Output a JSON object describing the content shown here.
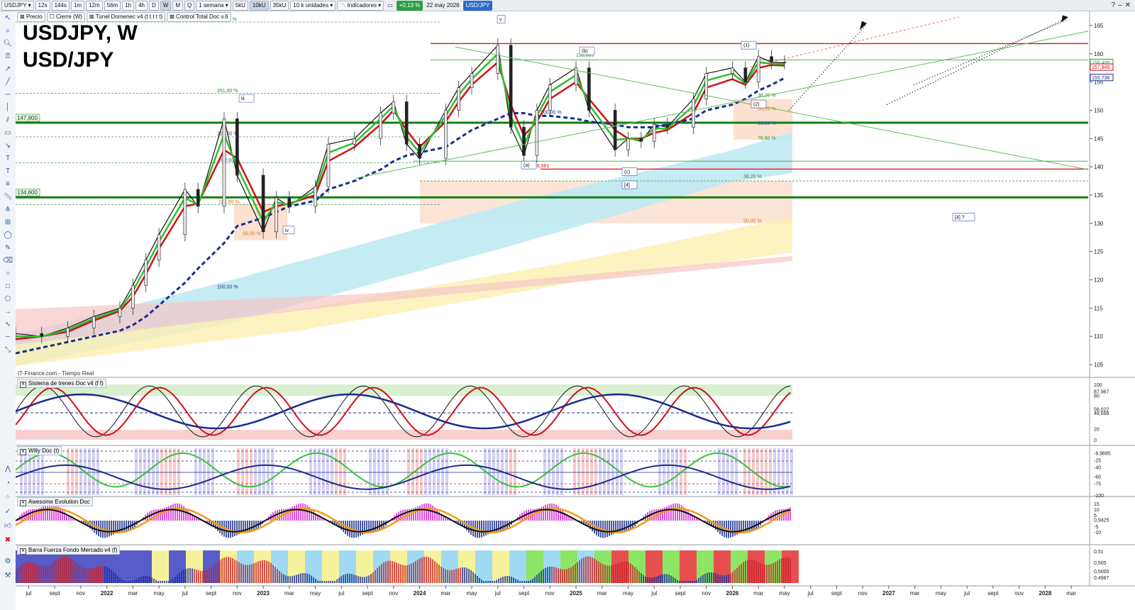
{
  "toolbar": {
    "symbol": "USDJPY",
    "intervals": [
      "12s",
      "144s",
      "1m",
      "12m",
      "56m",
      "1h",
      "4h",
      "D",
      "W",
      "M",
      "Q"
    ],
    "active_interval": "W",
    "period": "1 semana",
    "units": [
      "5kU",
      "10kU",
      "35kU"
    ],
    "active_unit": "10kU",
    "quantity": "10 k unidades",
    "indicators_label": "Indicadores",
    "change": "+0,13 %",
    "date": "22 may 2026",
    "pair_badge": "USD/JPY",
    "window_icons": [
      "help-icon",
      "minimize-icon",
      "close-icon"
    ]
  },
  "legend_bar": {
    "items": [
      "Precio",
      "Cierre (W)",
      "Tunel Domenec v4 (t t t t t)",
      "Control Total Doc v.6"
    ]
  },
  "main_title": {
    "line1": "USDJPY, W",
    "line2": "USD/JPY"
  },
  "watermark": "IT-Finance.com - Tiempo Real",
  "price_axis": {
    "ticks": [
      "165",
      "160",
      "155",
      "150",
      "145",
      "140",
      "135",
      "130",
      "125",
      "120",
      "115",
      "110",
      "105"
    ],
    "badges": [
      {
        "text": "158,408",
        "color": "#2e9c3a"
      },
      {
        "text": "157,949",
        "color": "#d0101a"
      },
      {
        "text": "155,736",
        "color": "#1a2d8c"
      }
    ]
  },
  "left_axis_labels": [
    "147,800",
    "134,600"
  ],
  "level_labels": {
    "fib_323": "323,60 %",
    "fib_261": "261,80 %",
    "fib_223": "223,60 %",
    "fib_200": "200,00 %",
    "fib_161": "161,80 %",
    "fib_50a": "50,00 %",
    "fib_100a": "100,00 %",
    "fib_100b": "100,00 %",
    "fib_b": "158,865",
    "low_a": "139,581",
    "fib_382a": "38,20 %",
    "fib_50b": "50,00 %",
    "fib_618": "61,80 %",
    "fib_786": "78,60 %",
    "fib_382b": "38,20 %",
    "fib_50c": "50,00 %"
  },
  "wave_labels": [
    "[3]",
    "v",
    "iii",
    "iv",
    "(a)",
    "(b)",
    "(c)",
    "[4]",
    "(1)",
    "(2)",
    "[4] ?"
  ],
  "x_axis": {
    "ticks": [
      "jul",
      "sept",
      "nov",
      "2022",
      "mar",
      "may",
      "jul",
      "sept",
      "nov",
      "2023",
      "mar",
      "may",
      "jul",
      "sept",
      "nov",
      "2024",
      "mar",
      "may",
      "jul",
      "sept",
      "nov",
      "2025",
      "mar",
      "may",
      "jul",
      "sept",
      "nov",
      "2026",
      "mar",
      "may",
      "jul",
      "sept",
      "nov",
      "2027",
      "mar",
      "may",
      "jul",
      "sept",
      "nov",
      "2028",
      "mar"
    ]
  },
  "panes": [
    {
      "title": "Sistema de trenes Doc v4 (f f)",
      "axis": [
        "100",
        "87,987",
        "80",
        "56,022",
        "48,668",
        "20",
        "0"
      ]
    },
    {
      "title": "Willy Doc (t)",
      "axis": [
        "-9,9685",
        "-25",
        "-40",
        "-60",
        "-75",
        "-100"
      ]
    },
    {
      "title": "Awesome Evolution Doc",
      "axis": [
        "15",
        "10",
        "5",
        "0,9425",
        "-5",
        "-10"
      ]
    },
    {
      "title": "Barra Fuerza Fondo Mercado v4 (f)",
      "axis": [
        "0,51",
        "0,505",
        "0,5000",
        "0,4987"
      ]
    }
  ],
  "chart_data": {
    "type": "line",
    "title": "USDJPY, W",
    "subtitle": "USD/JPY",
    "ylim": [
      103,
      167
    ],
    "x": [
      "2021-06",
      "2021-08",
      "2021-10",
      "2021-12",
      "2022-02",
      "2022-03",
      "2022-04",
      "2022-05",
      "2022-07",
      "2022-08",
      "2022-10",
      "2022-11",
      "2023-01",
      "2023-02",
      "2023-03",
      "2023-05",
      "2023-06",
      "2023-08",
      "2023-10",
      "2023-11",
      "2023-12",
      "2024-01",
      "2024-03",
      "2024-04",
      "2024-05",
      "2024-07",
      "2024-08",
      "2024-09",
      "2024-10",
      "2024-11",
      "2025-01",
      "2025-02",
      "2025-04",
      "2025-05",
      "2025-06",
      "2025-07",
      "2025-08",
      "2025-10",
      "2025-11",
      "2026-01",
      "2026-02",
      "2026-03",
      "2026-04",
      "2026-05"
    ],
    "series": [
      {
        "values": [
          110.5,
          110.0,
          111.5,
          113.5,
          115.0,
          119.0,
          123.5,
          128.0,
          136.0,
          133.0,
          148.5,
          138.5,
          128.5,
          134.5,
          133.0,
          136.5,
          144.0,
          145.0,
          149.5,
          151.5,
          144.0,
          141.5,
          150.0,
          154.0,
          156.5,
          161.5,
          147.0,
          142.0,
          150.0,
          154.5,
          157.5,
          150.0,
          143.0,
          145.0,
          144.5,
          147.5,
          147.0,
          152.0,
          156.5,
          157.5,
          155.0,
          159.5,
          158.5,
          158.4
        ],
        "color": "#111111"
      },
      {
        "values": [
          109.5,
          110.0,
          110.8,
          112.8,
          114.5,
          117.0,
          121.0,
          125.5,
          133.0,
          133.5,
          143.0,
          141.5,
          132.0,
          133.0,
          133.5,
          135.0,
          141.0,
          143.5,
          147.5,
          150.0,
          146.5,
          143.5,
          148.0,
          151.5,
          154.5,
          158.5,
          151.0,
          145.5,
          148.0,
          152.0,
          155.0,
          152.0,
          146.5,
          145.0,
          145.0,
          146.0,
          146.5,
          149.5,
          154.0,
          155.5,
          154.5,
          157.5,
          158.0,
          157.9
        ],
        "color": "#d0101a"
      },
      {
        "values": [
          107.0,
          108.0,
          109.0,
          110.0,
          111.0,
          112.0,
          113.5,
          115.5,
          119.5,
          122.0,
          126.5,
          129.5,
          131.0,
          132.0,
          133.0,
          134.0,
          136.0,
          137.5,
          139.5,
          141.0,
          142.0,
          142.5,
          143.5,
          145.0,
          146.5,
          148.5,
          149.5,
          149.5,
          149.0,
          149.0,
          148.5,
          148.0,
          147.5,
          147.0,
          147.0,
          147.0,
          147.5,
          148.5,
          150.0,
          151.0,
          152.0,
          153.5,
          154.5,
          155.7
        ],
        "color": "#1a2d8c"
      }
    ],
    "horizontal_levels": [
      161.8,
      158.9,
      147.8,
      141.0,
      139.6,
      134.6
    ]
  }
}
